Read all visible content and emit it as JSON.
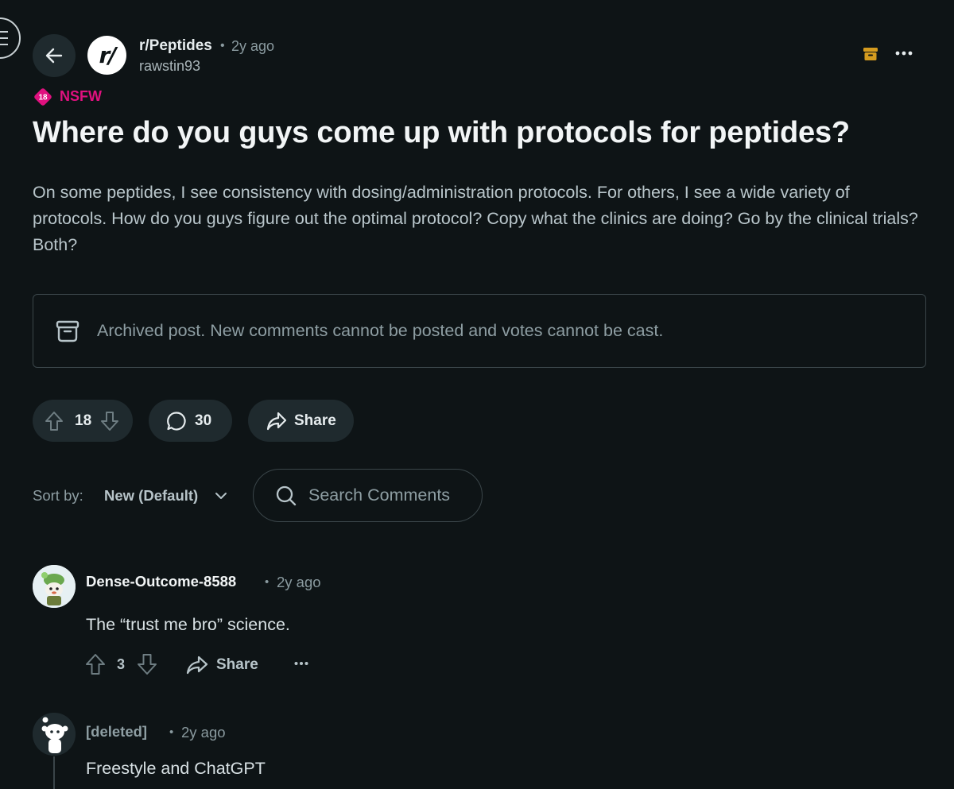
{
  "header": {
    "subreddit": "r/Peptides",
    "subreddit_avatar_text": "r/",
    "separator": "•",
    "post_age": "2y ago",
    "author": "rawstin93"
  },
  "badge": {
    "nsfw_number": "18",
    "nsfw_label": "NSFW"
  },
  "post": {
    "title": "Where do you guys come up with protocols for peptides?",
    "body": "On some peptides, I see consistency with dosing/administration protocols. For others, I see a wide variety of protocols. How do you guys figure out the optimal protocol? Copy what the clinics are doing? Go by the clinical trials? Both?",
    "archived_notice": "Archived post. New comments cannot be posted and votes cannot be cast.",
    "score": "18",
    "comment_count": "30",
    "share_label": "Share"
  },
  "comments_controls": {
    "sort_label": "Sort by:",
    "sort_value": "New (Default)",
    "search_placeholder": "Search Comments"
  },
  "comments": [
    {
      "author": "Dense-Outcome-8588",
      "separator": "•",
      "age": "2y ago",
      "text": "The “trust me bro” science.",
      "score": "3",
      "share_label": "Share"
    },
    {
      "author": "[deleted]",
      "separator": "•",
      "age": "2y ago",
      "text": "Freestyle and ChatGPT"
    }
  ],
  "colors": {
    "background": "#0e1416",
    "nsfw": "#e0117f",
    "archive_icon": "#d49b1f",
    "pill_bg": "#1f2a2e"
  },
  "icons": [
    "menu-icon",
    "back-arrow-icon",
    "archive-icon",
    "more-icon",
    "nsfw-icon",
    "upvote-icon",
    "downvote-icon",
    "comment-icon",
    "share-icon",
    "chevron-down-icon",
    "search-icon"
  ]
}
